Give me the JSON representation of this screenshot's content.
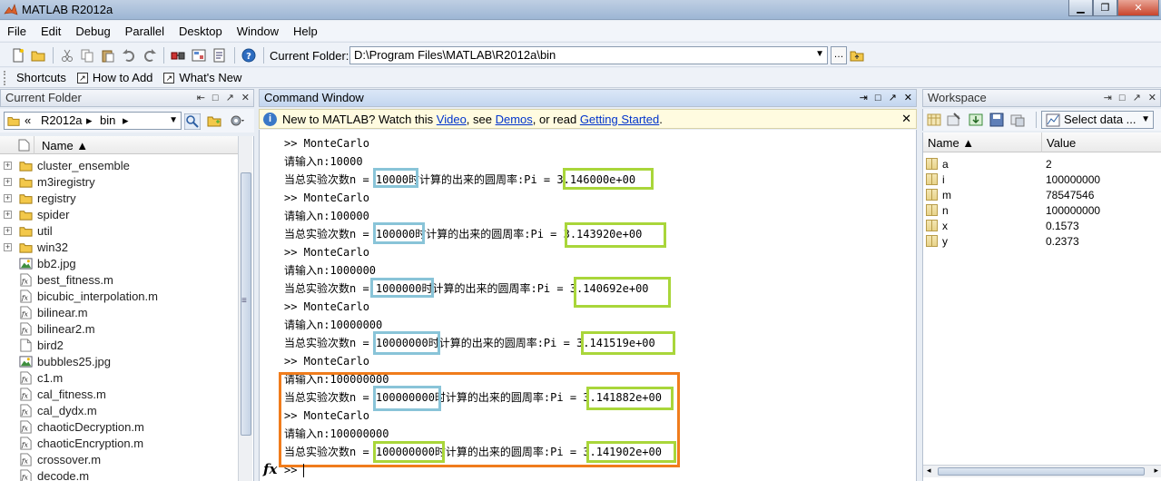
{
  "window": {
    "title": "MATLAB  R2012a"
  },
  "menu": [
    "File",
    "Edit",
    "Debug",
    "Parallel",
    "Desktop",
    "Window",
    "Help"
  ],
  "toolbar": {
    "current_folder_label": "Current Folder:",
    "current_folder_path": "D:\\Program Files\\MATLAB\\R2012a\\bin"
  },
  "shortcuts": {
    "label": "Shortcuts",
    "items": [
      "How to Add",
      "What's New"
    ]
  },
  "current_folder_panel": {
    "title": "Current Folder",
    "breadcrumb": [
      "«",
      "R2012a",
      "▸",
      "bin",
      "▸"
    ],
    "column_name": "Name ▲",
    "items": [
      {
        "name": "cluster_ensemble",
        "type": "folder"
      },
      {
        "name": "m3iregistry",
        "type": "folder"
      },
      {
        "name": "registry",
        "type": "folder"
      },
      {
        "name": "spider",
        "type": "folder"
      },
      {
        "name": "util",
        "type": "folder"
      },
      {
        "name": "win32",
        "type": "folder"
      },
      {
        "name": "bb2.jpg",
        "type": "image"
      },
      {
        "name": "best_fitness.m",
        "type": "mfile"
      },
      {
        "name": "bicubic_interpolation.m",
        "type": "mfile"
      },
      {
        "name": "bilinear.m",
        "type": "mfile"
      },
      {
        "name": "bilinear2.m",
        "type": "mfile"
      },
      {
        "name": "bird2",
        "type": "file"
      },
      {
        "name": "bubbles25.jpg",
        "type": "image"
      },
      {
        "name": "c1.m",
        "type": "mfile"
      },
      {
        "name": "cal_fitness.m",
        "type": "mfile"
      },
      {
        "name": "cal_dydx.m",
        "type": "mfile"
      },
      {
        "name": "chaoticDecryption.m",
        "type": "mfile"
      },
      {
        "name": "chaoticEncryption.m",
        "type": "mfile"
      },
      {
        "name": "crossover.m",
        "type": "mfile"
      },
      {
        "name": "decode.m",
        "type": "mfile"
      }
    ]
  },
  "command_window": {
    "title": "Command Window",
    "info": {
      "prefix": "New to MATLAB? Watch this ",
      "link_video": "Video",
      "mid1": ", see ",
      "link_demos": "Demos",
      "mid2": ", or read ",
      "link_getting_started": "Getting Started",
      "suffix": "."
    },
    "lines": [
      ">> MonteCarlo",
      "请输入n:10000",
      "当总实验次数n = 10000时计算的出来的圆周率:Pi = 3.146000e+00",
      ">> MonteCarlo",
      "请输入n:100000",
      "当总实验次数n = 100000时计算的出来的圆周率:Pi = 3.143920e+00",
      ">> MonteCarlo",
      "请输入n:1000000",
      "当总实验次数n = 1000000时计算的出来的圆周率:Pi = 3.140692e+00",
      ">> MonteCarlo",
      "请输入n:10000000",
      "当总实验次数n = 10000000时计算的出来的圆周率:Pi = 3.141519e+00",
      ">> MonteCarlo",
      "请输入n:100000000",
      "当总实验次数n = 100000000时计算的出来的圆周率:Pi = 3.141882e+00",
      ">> MonteCarlo",
      "请输入n:100000000",
      "当总实验次数n = 100000000时计算的出来的圆周率:Pi = 3.141902e+00"
    ],
    "prompt": ">>",
    "fx_label": "fx"
  },
  "workspace": {
    "title": "Workspace",
    "select_label": "Select data ...",
    "columns": [
      "Name ▲",
      "Value"
    ],
    "vars": [
      {
        "name": "a",
        "value": "2"
      },
      {
        "name": "i",
        "value": "100000000"
      },
      {
        "name": "m",
        "value": "78547546"
      },
      {
        "name": "n",
        "value": "100000000"
      },
      {
        "name": "x",
        "value": "0.1573"
      },
      {
        "name": "y",
        "value": "0.2373"
      }
    ]
  }
}
